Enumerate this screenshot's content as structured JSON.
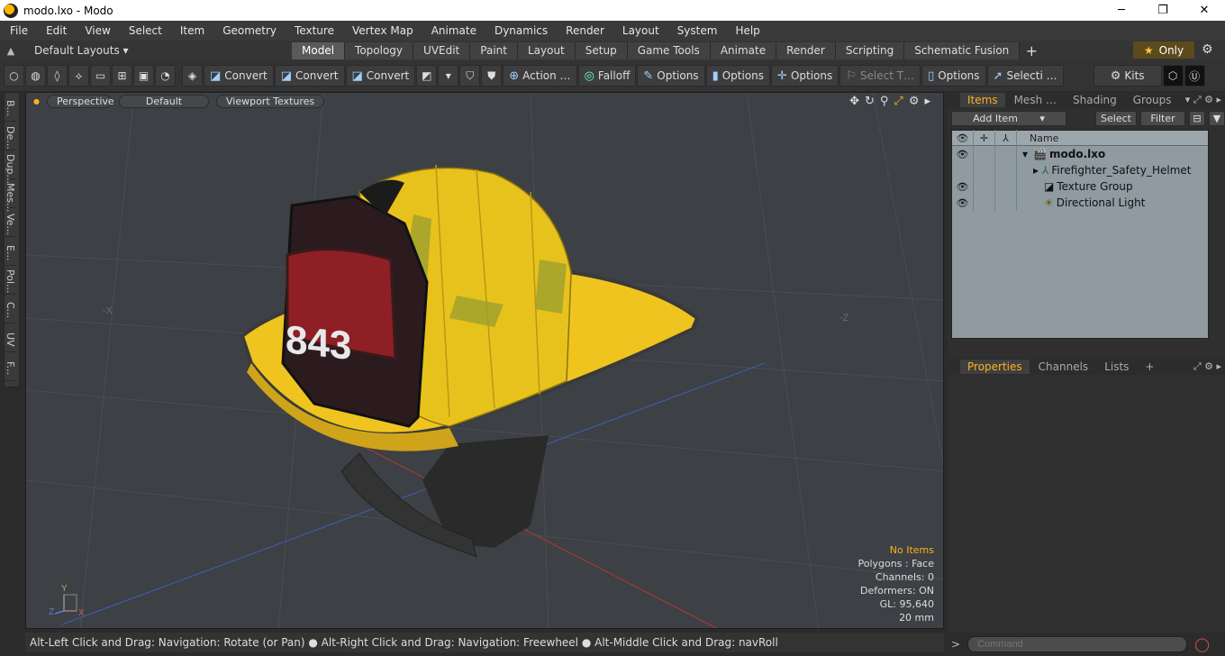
{
  "window": {
    "title": "modo.lxo - Modo",
    "minimize": "─",
    "maximize": "❐",
    "close": "✕"
  },
  "menu": [
    "File",
    "Edit",
    "View",
    "Select",
    "Item",
    "Geometry",
    "Texture",
    "Vertex Map",
    "Animate",
    "Dynamics",
    "Render",
    "Layout",
    "System",
    "Help"
  ],
  "layoutbar": {
    "default_layouts": "Default Layouts ▾",
    "tabs": [
      "Model",
      "Topology",
      "UVEdit",
      "Paint",
      "Layout",
      "Setup",
      "Game Tools",
      "Animate",
      "Render",
      "Scripting",
      "Schematic Fusion"
    ],
    "active_tab": "Model",
    "add": "+",
    "only": "Only"
  },
  "toolbar": {
    "convert": "Convert",
    "action": "Action …",
    "falloff": "Falloff",
    "options": "Options",
    "select_t": "Select T…",
    "selecti": "Selecti …",
    "kits": "Kits"
  },
  "lefttabs": [
    "B...",
    "De...",
    "Dup...",
    "Mes...",
    "Ve...",
    "E...",
    "Pol...",
    "C...",
    "UV",
    "F..."
  ],
  "viewport": {
    "mode": "Perspective",
    "style": "Default",
    "textures": "Viewport Textures",
    "stats": {
      "no_items": "No Items",
      "polygons": "Polygons : Face",
      "channels": "Channels: 0",
      "deformers": "Deformers: ON",
      "gl": "GL: 95,640",
      "scale": "20 mm"
    },
    "axis_x": "-X",
    "axis_z": "-Z",
    "gizmo": {
      "y": "Y",
      "z": "Z",
      "x": "X"
    },
    "helmet_number": "843"
  },
  "status": "Alt-Left Click and Drag: Navigation: Rotate (or Pan) ● Alt-Right Click and Drag: Navigation: Freewheel ● Alt-Middle Click and Drag: navRoll",
  "items_panel": {
    "tabs": [
      "Items",
      "Mesh …",
      "Shading",
      "Groups"
    ],
    "add_item": "Add Item",
    "select": "Select",
    "filter": "Filter",
    "col_name": "Name",
    "rows": [
      {
        "name": "modo.lxo",
        "indent": 0,
        "eye": true
      },
      {
        "name": "Firefighter_Safety_Helmet",
        "indent": 1,
        "eye": false
      },
      {
        "name": "Texture Group",
        "indent": 1,
        "eye": true
      },
      {
        "name": "Directional Light",
        "indent": 1,
        "eye": true
      }
    ]
  },
  "props_panel": {
    "tabs": [
      "Properties",
      "Channels",
      "Lists"
    ],
    "add": "+"
  },
  "command": {
    "placeholder": "Command"
  },
  "colors": {
    "accent": "#ffb020",
    "helmet": "#e8c21c",
    "viewport": "#3d4044"
  }
}
